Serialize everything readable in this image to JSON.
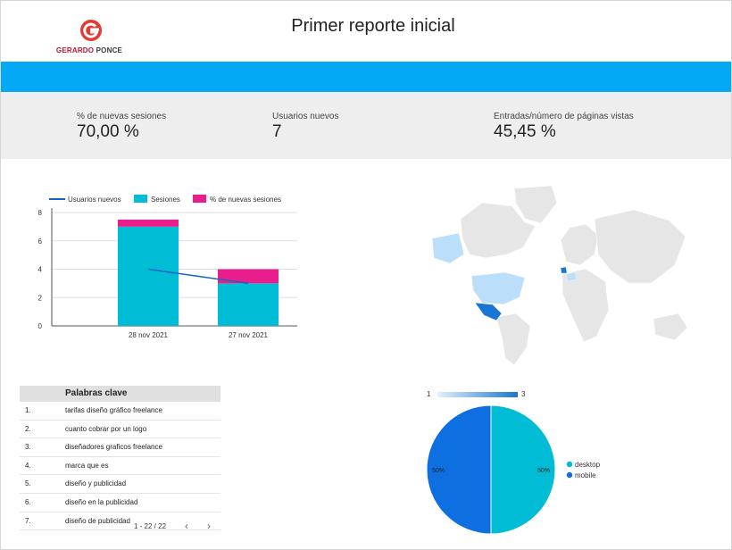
{
  "header": {
    "title": "Primer reporte inicial",
    "logo_part1": "GERARDO",
    "logo_part2": "PONCE"
  },
  "kpis": [
    {
      "label": "% de nuevas sesiones",
      "value": "70,00 %"
    },
    {
      "label": "Usuarios nuevos",
      "value": "7"
    },
    {
      "label": "Entradas/número de páginas vistas",
      "value": "45,45 %"
    }
  ],
  "colors": {
    "accent_bar": "#03a9f4",
    "sessions": "#00bcd4",
    "new_sessions_pct": "#e91e8c",
    "new_users": "#1565c0",
    "map_land": "#e6e6e6",
    "map_low": "#bbdefb",
    "map_high": "#1976d2",
    "pie_desktop": "#00bcd4",
    "pie_mobile": "#0d6fe0"
  },
  "chart_data": [
    {
      "type": "bar",
      "legend": [
        "Usuarios nuevos",
        "Sesiones",
        "% de nuevas sesiones"
      ],
      "categories": [
        "28 nov 2021",
        "27 nov 2021"
      ],
      "series": [
        {
          "name": "Usuarios nuevos",
          "type": "line",
          "values": [
            4,
            3
          ]
        },
        {
          "name": "Sesiones",
          "values": [
            7,
            3
          ]
        },
        {
          "name": "% de nuevas sesiones",
          "values": [
            0.5,
            1
          ]
        }
      ],
      "yticks": [
        0,
        2,
        4,
        6,
        8
      ],
      "ylim": [
        0,
        8
      ],
      "grid": true,
      "legend_position": "top"
    },
    {
      "type": "pie",
      "labels": [
        "desktop",
        "mobile"
      ],
      "values": [
        50,
        50
      ],
      "slice_labels": [
        "50%",
        "50%"
      ],
      "legend_position": "right"
    }
  ],
  "map": {
    "scale_min": "1",
    "scale_max": "3"
  },
  "keywords": {
    "header": "Palabras clave",
    "rows": [
      {
        "num": "1.",
        "kw": "tarifas diseño gráfico freelance"
      },
      {
        "num": "2.",
        "kw": "cuanto cobrar por un logo"
      },
      {
        "num": "3.",
        "kw": "diseñadores graficos freelance"
      },
      {
        "num": "4.",
        "kw": "marca que es"
      },
      {
        "num": "5.",
        "kw": "diseño y publicidad"
      },
      {
        "num": "6.",
        "kw": "diseño en la publicidad"
      },
      {
        "num": "7.",
        "kw": "diseño de publicidad"
      }
    ],
    "pager": "1 - 22 / 22"
  }
}
